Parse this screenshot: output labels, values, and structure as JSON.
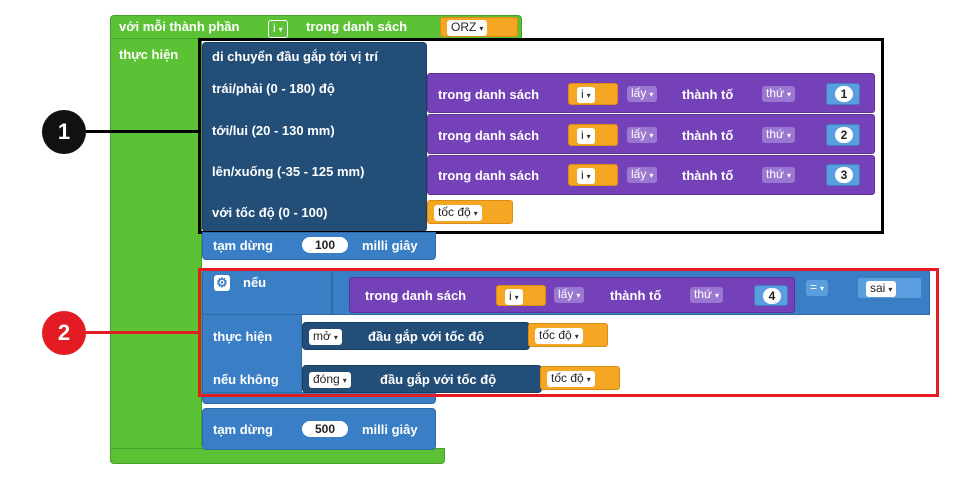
{
  "foreach": {
    "label_prefix": "với mỗi thành phần",
    "var": "i",
    "label_mid": "trong danh sách",
    "list": "ORZ",
    "do_label": "thực hiện"
  },
  "move": {
    "title": "di chuyển đầu gắp tới vị trí",
    "params": [
      "trái/phải (0 - 180) độ",
      "tới/lui (20 - 130 mm)",
      "lên/xuống (-35 - 125 mm)",
      "với tốc độ (0 - 100)"
    ],
    "speed_var": "tốc độ",
    "list_label": "trong danh sách",
    "var": "i",
    "get": "lấy",
    "element_label": "thành tố",
    "which": "thứ",
    "indices": [
      "1",
      "2",
      "3"
    ]
  },
  "pause1": {
    "label": "tạm dừng",
    "value": "100",
    "unit": "milli giây"
  },
  "ifblock": {
    "if_label": "nếu",
    "list_label": "trong danh sách",
    "var": "i",
    "get": "lấy",
    "element_label": "thành tố",
    "which": "thứ",
    "index": "4",
    "op": "=",
    "value": "sai",
    "then_label": "thực hiện",
    "then_action": "mở",
    "then_text": "đầu gắp với tốc độ",
    "speed_var": "tốc độ",
    "else_label": "nếu không",
    "else_action": "đóng",
    "else_text": "đầu gắp với tốc độ",
    "else_speed_var": "tốc độ"
  },
  "pause2": {
    "label": "tạm dừng",
    "value": "500",
    "unit": "milli giây"
  },
  "callouts": [
    "1",
    "2"
  ],
  "colors": {
    "callout1": "#111111",
    "callout2": "#e31b23",
    "box1": "#000000",
    "box2": "#e31b23"
  }
}
